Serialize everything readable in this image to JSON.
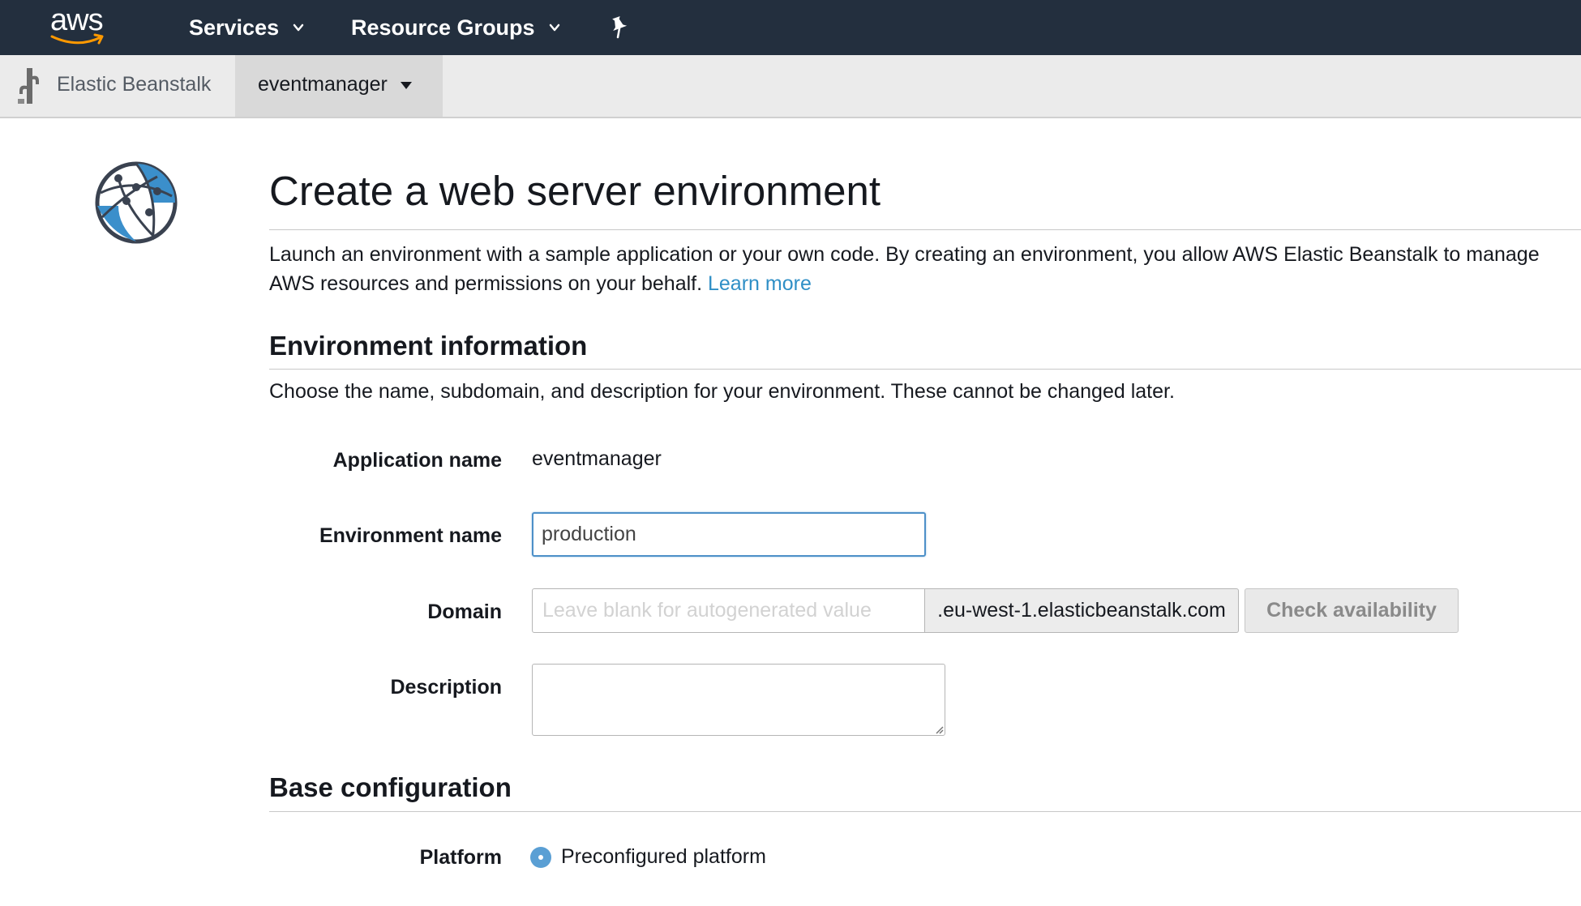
{
  "topnav": {
    "logo_text": "aws",
    "services_label": "Services",
    "resource_groups_label": "Resource Groups",
    "background": "#232f3e"
  },
  "subnav": {
    "service_name": "Elastic Beanstalk",
    "application_tab": "eventmanager"
  },
  "main": {
    "title": "Create a web server environment",
    "intro_text": "Launch an environment with a sample application or your own code. By creating an environment, you allow AWS Elastic Beanstalk to manage AWS resources and permissions on your behalf.",
    "learn_more": "Learn more",
    "env_info": {
      "title": "Environment information",
      "description": "Choose the name, subdomain, and description for your environment. These cannot be changed later.",
      "application_name_label": "Application name",
      "application_name_value": "eventmanager",
      "environment_name_label": "Environment name",
      "environment_name_value": "production",
      "domain_label": "Domain",
      "domain_placeholder": "Leave blank for autogenerated value",
      "domain_suffix": ".eu-west-1.elasticbeanstalk.com",
      "check_availability": "Check availability",
      "description_label": "Description",
      "description_value": ""
    },
    "base_config": {
      "title": "Base configuration",
      "platform_label": "Platform",
      "platform_option": "Preconfigured platform"
    }
  },
  "colors": {
    "link": "#2f8fc6",
    "input_focus_border": "#4d90c8",
    "radio": "#5a9fd4"
  }
}
